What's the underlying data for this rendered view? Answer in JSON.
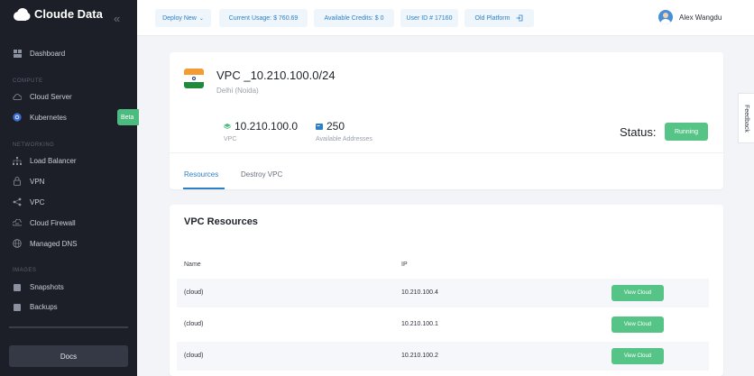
{
  "brand": {
    "name": "Cloude Data",
    "collapse_icon": "double-chevron-left-icon"
  },
  "sidebar": {
    "dashboard": "Dashboard",
    "section_compute": "COMPUTE",
    "cloud_server": "Cloud Server",
    "kubernetes": "Kubernetes",
    "kubernetes_badge": "Beta",
    "section_networking": "NETWORKING",
    "load_balancer": "Load Balancer",
    "vpn": "VPN",
    "vpc": "VPC",
    "cloud_firewall": "Cloud Firewall",
    "managed_dns": "Managed DNS",
    "section_images": "IMAGES",
    "snapshots": "Snapshots",
    "backups": "Backups",
    "docs": "Docs"
  },
  "topbar": {
    "deploy_new": "Deploy New",
    "current_usage": "Current Usage: $ 760.69",
    "available_credits": "Available Credits: $ 0",
    "user_id": "User ID # 17160",
    "old_platform": "Old Platform",
    "user_name": "Alex Wangdu"
  },
  "vpc": {
    "title": "VPC _10.210.100.0/24",
    "location": "Delhi (Noida)",
    "ip_value": "10.210.100.0",
    "ip_label": "VPC",
    "addresses_value": "250",
    "addresses_label": "Available Addresses",
    "status_label": "Status:",
    "status_value": "Running",
    "tabs": [
      "Resources",
      "Destroy VPC"
    ]
  },
  "resources": {
    "title": "VPC Resources",
    "columns": [
      "Name",
      "IP"
    ],
    "rows": [
      {
        "name": "(cloud)",
        "ip": "10.210.100.4",
        "action": "View Cloud"
      },
      {
        "name": "(cloud)",
        "ip": "10.210.100.1",
        "action": "View Cloud"
      },
      {
        "name": "(cloud)",
        "ip": "10.210.100.2",
        "action": "View Cloud"
      }
    ]
  },
  "feedback": "Feedback",
  "colors": {
    "accent": "#2f7fc4",
    "success": "#56c486",
    "sidebar_bg": "#1c1f27"
  }
}
